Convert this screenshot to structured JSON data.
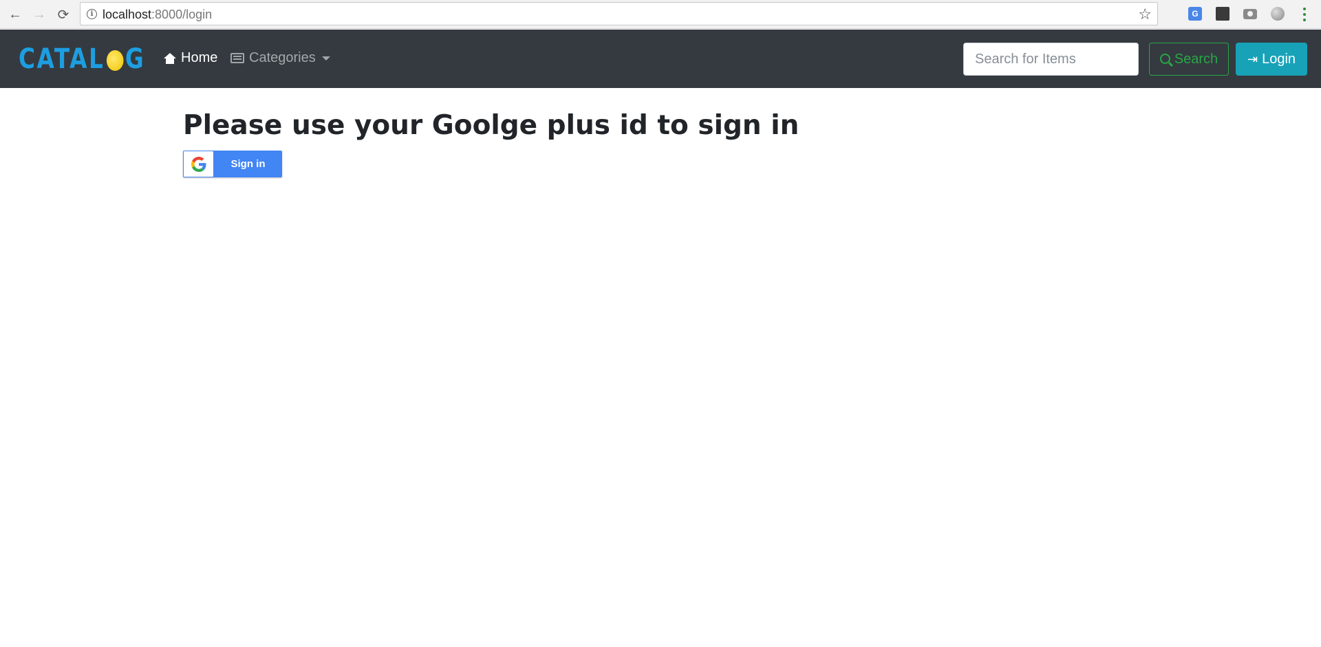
{
  "browser": {
    "url_host": "localhost",
    "url_rest": ":8000/login",
    "back_icon": "←",
    "forward_icon": "→",
    "reload_icon": "⟳",
    "info_icon": "i",
    "star_icon": "☆",
    "translate_icon": "G",
    "bulb_icon": "💡"
  },
  "navbar": {
    "brand": {
      "prefix": "CATAL",
      "suffix": "G"
    },
    "home_label": "Home",
    "categories_label": "Categories",
    "search_placeholder": "Search for Items",
    "search_button": "Search",
    "login_button": "Login",
    "login_icon": "⇥"
  },
  "main": {
    "heading": "Please use your Goolge plus id to sign in",
    "google_button": "Sign in"
  },
  "colors": {
    "navbar_bg": "#343a40",
    "brand": "#1d9ee0",
    "search_green": "#28a745",
    "login_teal": "#17a2b8",
    "google_blue": "#4285f4"
  }
}
